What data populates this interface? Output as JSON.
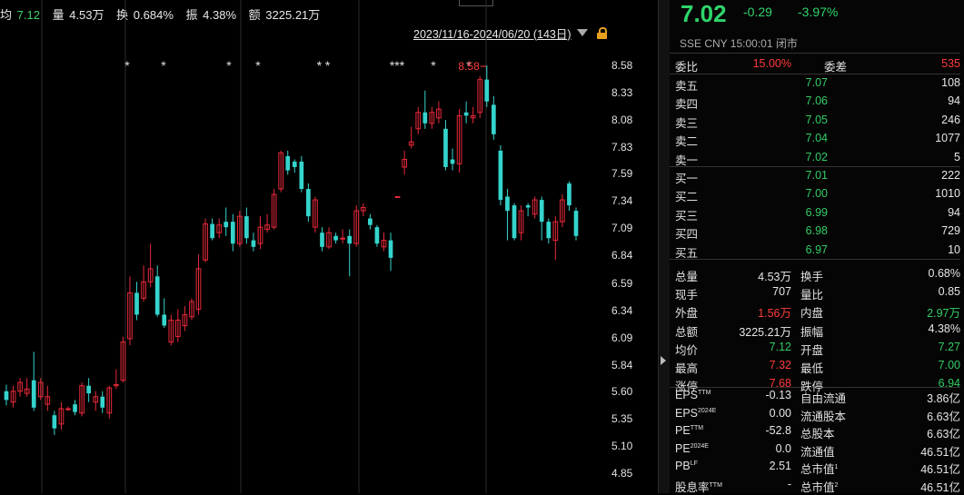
{
  "chart_data": {
    "type": "candlestick",
    "y_ticks": [
      "8.58",
      "8.33",
      "8.08",
      "7.83",
      "7.59",
      "7.34",
      "7.09",
      "6.84",
      "6.59",
      "6.34",
      "6.09",
      "5.84",
      "5.60",
      "5.35",
      "5.10",
      "4.85"
    ],
    "ylim": [
      4.85,
      8.58
    ],
    "high_label": "8.58",
    "star_groups": [
      "*",
      "*",
      "*",
      "*",
      "* *",
      "***",
      "*",
      "*"
    ],
    "candles": [
      {
        "o": 5.6,
        "c": 5.52,
        "h": 5.66,
        "l": 5.47
      },
      {
        "o": 5.5,
        "c": 5.6,
        "h": 5.65,
        "l": 5.45
      },
      {
        "o": 5.6,
        "c": 5.68,
        "h": 5.72,
        "l": 5.55
      },
      {
        "o": 5.58,
        "c": 5.62,
        "h": 5.72,
        "l": 5.55
      },
      {
        "o": 5.7,
        "c": 5.45,
        "h": 5.96,
        "l": 5.42
      },
      {
        "o": 5.55,
        "c": 5.68,
        "h": 5.72,
        "l": 5.52
      },
      {
        "o": 5.48,
        "c": 5.55,
        "h": 5.65,
        "l": 5.42
      },
      {
        "o": 5.38,
        "c": 5.26,
        "h": 5.42,
        "l": 5.2
      },
      {
        "o": 5.3,
        "c": 5.44,
        "h": 5.5,
        "l": 5.25
      },
      {
        "o": 5.44,
        "c": 5.44,
        "h": 5.46,
        "l": 5.42
      },
      {
        "o": 5.48,
        "c": 5.41,
        "h": 5.52,
        "l": 5.38
      },
      {
        "o": 5.4,
        "c": 5.65,
        "h": 5.68,
        "l": 5.37
      },
      {
        "o": 5.65,
        "c": 5.58,
        "h": 5.72,
        "l": 5.5
      },
      {
        "o": 5.5,
        "c": 5.55,
        "h": 5.6,
        "l": 5.42
      },
      {
        "o": 5.55,
        "c": 5.45,
        "h": 5.6,
        "l": 5.4
      },
      {
        "o": 5.4,
        "c": 5.63,
        "h": 5.65,
        "l": 5.35
      },
      {
        "o": 5.65,
        "c": 5.66,
        "h": 5.8,
        "l": 5.62
      },
      {
        "o": 5.7,
        "c": 6.05,
        "h": 6.1,
        "l": 5.68
      },
      {
        "o": 6.08,
        "c": 6.5,
        "h": 6.65,
        "l": 6.02
      },
      {
        "o": 6.5,
        "c": 6.3,
        "h": 6.6,
        "l": 6.25
      },
      {
        "o": 6.45,
        "c": 6.6,
        "h": 6.75,
        "l": 6.42
      },
      {
        "o": 6.6,
        "c": 6.72,
        "h": 6.95,
        "l": 6.55
      },
      {
        "o": 6.65,
        "c": 6.3,
        "h": 6.75,
        "l": 6.28
      },
      {
        "o": 6.3,
        "c": 6.2,
        "h": 6.45,
        "l": 6.18
      },
      {
        "o": 6.05,
        "c": 6.25,
        "h": 6.3,
        "l": 6.02
      },
      {
        "o": 6.1,
        "c": 6.25,
        "h": 6.35,
        "l": 6.05
      },
      {
        "o": 6.2,
        "c": 6.3,
        "h": 6.38,
        "l": 6.15
      },
      {
        "o": 6.28,
        "c": 6.42,
        "h": 6.45,
        "l": 6.25
      },
      {
        "o": 6.35,
        "c": 6.72,
        "h": 6.85,
        "l": 6.3
      },
      {
        "o": 6.8,
        "c": 7.13,
        "h": 7.18,
        "l": 6.78
      },
      {
        "o": 7.13,
        "c": 7.0,
        "h": 7.18,
        "l": 6.98
      },
      {
        "o": 7.05,
        "c": 7.12,
        "h": 7.18,
        "l": 7.0
      },
      {
        "o": 7.15,
        "c": 7.1,
        "h": 7.28,
        "l": 7.02
      },
      {
        "o": 7.15,
        "c": 6.95,
        "h": 7.22,
        "l": 6.88
      },
      {
        "o": 6.95,
        "c": 7.2,
        "h": 7.25,
        "l": 6.92
      },
      {
        "o": 7.2,
        "c": 7.0,
        "h": 7.28,
        "l": 6.95
      },
      {
        "o": 6.98,
        "c": 6.92,
        "h": 7.05,
        "l": 6.88
      },
      {
        "o": 6.95,
        "c": 7.1,
        "h": 7.2,
        "l": 6.9
      },
      {
        "o": 7.08,
        "c": 7.12,
        "h": 7.22,
        "l": 7.05
      },
      {
        "o": 7.1,
        "c": 7.4,
        "h": 7.45,
        "l": 7.08
      },
      {
        "o": 7.45,
        "c": 7.78,
        "h": 7.8,
        "l": 7.42
      },
      {
        "o": 7.75,
        "c": 7.62,
        "h": 7.8,
        "l": 7.58
      },
      {
        "o": 7.7,
        "c": 7.65,
        "h": 7.72,
        "l": 7.6
      },
      {
        "o": 7.7,
        "c": 7.45,
        "h": 7.75,
        "l": 7.42
      },
      {
        "o": 7.45,
        "c": 7.2,
        "h": 7.5,
        "l": 7.15
      },
      {
        "o": 7.1,
        "c": 7.35,
        "h": 7.38,
        "l": 7.05
      },
      {
        "o": 7.05,
        "c": 6.92,
        "h": 7.1,
        "l": 6.88
      },
      {
        "o": 6.92,
        "c": 7.05,
        "h": 7.1,
        "l": 6.9
      },
      {
        "o": 7.02,
        "c": 6.98,
        "h": 7.05,
        "l": 6.95
      },
      {
        "o": 7.0,
        "c": 7.0,
        "h": 7.08,
        "l": 6.95
      },
      {
        "o": 7.02,
        "c": 6.95,
        "h": 7.08,
        "l": 6.65
      },
      {
        "o": 6.95,
        "c": 7.25,
        "h": 7.3,
        "l": 6.92
      },
      {
        "o": 7.25,
        "c": 7.28,
        "h": 7.32,
        "l": 7.2
      },
      {
        "o": 7.18,
        "c": 7.12,
        "h": 7.22,
        "l": 7.08
      },
      {
        "o": 7.1,
        "c": 6.95,
        "h": 7.12,
        "l": 6.92
      },
      {
        "o": 6.92,
        "c": 6.98,
        "h": 7.05,
        "l": 6.88
      },
      {
        "o": 6.98,
        "c": 6.82,
        "h": 7.05,
        "l": 6.7
      },
      {
        "o": 7.38,
        "c": 7.38,
        "h": 7.38,
        "l": 7.38
      },
      {
        "o": 7.65,
        "c": 7.72,
        "h": 7.8,
        "l": 7.58
      },
      {
        "o": 7.85,
        "c": 7.88,
        "h": 8.02,
        "l": 7.82
      },
      {
        "o": 8.0,
        "c": 8.15,
        "h": 8.2,
        "l": 7.95
      },
      {
        "o": 8.15,
        "c": 8.05,
        "h": 8.35,
        "l": 8.0
      },
      {
        "o": 8.05,
        "c": 8.15,
        "h": 8.2,
        "l": 8.0
      },
      {
        "o": 8.1,
        "c": 8.18,
        "h": 8.25,
        "l": 8.05
      },
      {
        "o": 8.0,
        "c": 7.65,
        "h": 8.08,
        "l": 7.62
      },
      {
        "o": 7.72,
        "c": 7.68,
        "h": 7.82,
        "l": 7.62
      },
      {
        "o": 7.68,
        "c": 8.12,
        "h": 8.18,
        "l": 7.6
      },
      {
        "o": 8.15,
        "c": 8.12,
        "h": 8.25,
        "l": 8.05
      },
      {
        "o": 8.1,
        "c": 8.12,
        "h": 8.2,
        "l": 8.05
      },
      {
        "o": 8.15,
        "c": 8.45,
        "h": 8.48,
        "l": 8.1
      },
      {
        "o": 8.45,
        "c": 8.25,
        "h": 8.58,
        "l": 8.2
      },
      {
        "o": 8.22,
        "c": 7.95,
        "h": 8.3,
        "l": 7.9
      },
      {
        "o": 7.8,
        "c": 7.35,
        "h": 7.85,
        "l": 7.3
      },
      {
        "o": 7.38,
        "c": 7.25,
        "h": 7.45,
        "l": 6.98
      },
      {
        "o": 7.3,
        "c": 7.0,
        "h": 7.32,
        "l": 6.98
      },
      {
        "o": 7.05,
        "c": 7.25,
        "h": 7.3,
        "l": 6.98
      },
      {
        "o": 7.3,
        "c": 7.28,
        "h": 7.32,
        "l": 7.2
      },
      {
        "o": 7.22,
        "c": 7.35,
        "h": 7.38,
        "l": 7.18
      },
      {
        "o": 7.35,
        "c": 7.15,
        "h": 7.38,
        "l": 6.98
      },
      {
        "o": 7.15,
        "c": 7.0,
        "h": 7.18,
        "l": 6.95
      },
      {
        "o": 6.98,
        "c": 7.15,
        "h": 7.2,
        "l": 6.8
      },
      {
        "o": 7.15,
        "c": 7.35,
        "h": 7.4,
        "l": 7.1
      },
      {
        "o": 7.5,
        "c": 7.3,
        "h": 7.52,
        "l": 7.25
      },
      {
        "o": 7.25,
        "c": 7.02,
        "h": 7.28,
        "l": 6.98
      }
    ]
  },
  "header": {
    "avg_label": "均",
    "avg_value": "7.12",
    "vol_label": "量",
    "vol_value": "4.53万",
    "turnover_label": "换",
    "turnover_value": "0.684%",
    "amp_label": "振",
    "amp_value": "4.38%",
    "amount_label": "额",
    "amount_value": "3225.21万",
    "date_range": "2023/11/16-2024/06/20 (143日)"
  },
  "quote": {
    "price": "7.02",
    "change": "-0.29",
    "change_pct": "-3.97%",
    "status": "SSE  CNY  15:00:01  闭市"
  },
  "order_book": {
    "weibi_label": "委比",
    "weibi_value": "15.00%",
    "weicha_label": "委差",
    "weicha_value": "535",
    "asks": [
      {
        "label": "卖五",
        "price": "7.07",
        "vol": "108"
      },
      {
        "label": "卖四",
        "price": "7.06",
        "vol": "94"
      },
      {
        "label": "卖三",
        "price": "7.05",
        "vol": "246"
      },
      {
        "label": "卖二",
        "price": "7.04",
        "vol": "1077"
      },
      {
        "label": "卖一",
        "price": "7.02",
        "vol": "5"
      }
    ],
    "bids": [
      {
        "label": "买一",
        "price": "7.01",
        "vol": "222"
      },
      {
        "label": "买二",
        "price": "7.00",
        "vol": "1010"
      },
      {
        "label": "买三",
        "price": "6.99",
        "vol": "94"
      },
      {
        "label": "买四",
        "price": "6.98",
        "vol": "729"
      },
      {
        "label": "买五",
        "price": "6.97",
        "vol": "10"
      }
    ]
  },
  "stats": [
    {
      "l1": "总量",
      "v1": "4.53万",
      "c1": "white",
      "l2": "换手",
      "v2": "0.68%",
      "c2": "white"
    },
    {
      "l1": "现手",
      "v1": "707",
      "c1": "white",
      "l2": "量比",
      "v2": "0.85",
      "c2": "white"
    },
    {
      "l1": "外盘",
      "v1": "1.56万",
      "c1": "red",
      "l2": "内盘",
      "v2": "2.97万",
      "c2": "green"
    },
    {
      "l1": "总额",
      "v1": "3225.21万",
      "c1": "white",
      "l2": "振幅",
      "v2": "4.38%",
      "c2": "white"
    },
    {
      "l1": "均价",
      "v1": "7.12",
      "c1": "green",
      "l2": "开盘",
      "v2": "7.27",
      "c2": "green"
    },
    {
      "l1": "最高",
      "v1": "7.32",
      "c1": "red",
      "l2": "最低",
      "v2": "7.00",
      "c2": "green"
    },
    {
      "l1": "涨停",
      "v1": "7.68",
      "c1": "red",
      "l2": "跌停",
      "v2": "6.94",
      "c2": "green"
    }
  ],
  "fundamentals": [
    {
      "l1": "EPS",
      "s1": "TTM",
      "v1": "-0.13",
      "l2": "自由流通",
      "s2": "",
      "v2": "3.86亿"
    },
    {
      "l1": "EPS",
      "s1": "2024E",
      "v1": "0.00",
      "l2": "流通股本",
      "s2": "",
      "v2": "6.63亿"
    },
    {
      "l1": "PE",
      "s1": "TTM",
      "v1": "-52.8",
      "l2": "总股本",
      "s2": "",
      "v2": "6.63亿"
    },
    {
      "l1": "PE",
      "s1": "2024E",
      "v1": "0.0",
      "l2": "流通值",
      "s2": "",
      "v2": "46.51亿"
    },
    {
      "l1": "PB",
      "s1": "LF",
      "v1": "2.51",
      "l2": "总市值",
      "s2": "1",
      "v2": "46.51亿"
    },
    {
      "l1": "股息率",
      "s1": "TTM",
      "v1": "-",
      "l2": "总市值",
      "s2": "2",
      "v2": "46.51亿"
    }
  ],
  "colors": {
    "up": "#e8293a",
    "down": "#35d4cc",
    "price_green": "#2fd46b",
    "red": "#ff3b3b"
  }
}
